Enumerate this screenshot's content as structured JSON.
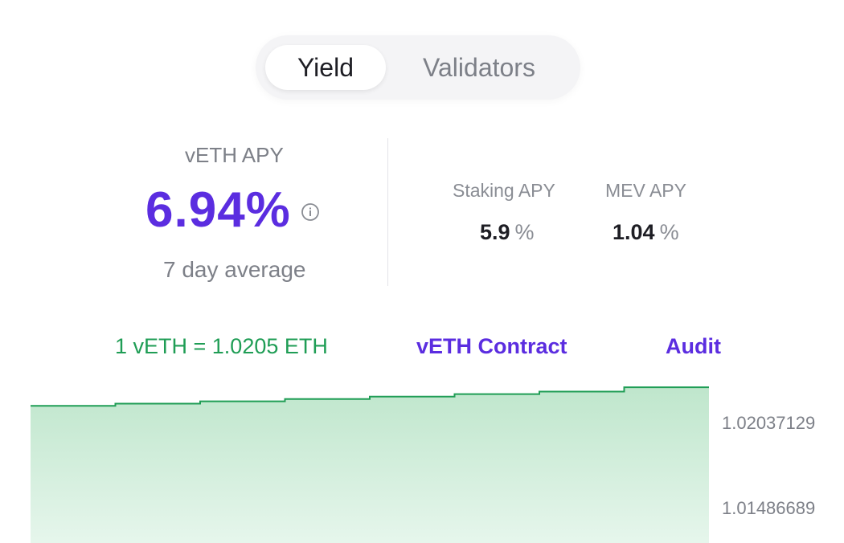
{
  "tabs": {
    "items": [
      {
        "label": "Yield",
        "active": true
      },
      {
        "label": "Validators",
        "active": false
      }
    ]
  },
  "apy": {
    "label": "vETH APY",
    "value": "6.94%",
    "info_icon": "info-circle-icon",
    "subtitle": "7 day average"
  },
  "breakdown": {
    "staking": {
      "label": "Staking APY",
      "value": "5.9",
      "unit": "%"
    },
    "mev": {
      "label": "MEV APY",
      "value": "1.04",
      "unit": "%"
    }
  },
  "links": {
    "rate": "1 vETH = 1.0205 ETH",
    "contract": "vETH Contract",
    "audit": "Audit"
  },
  "colors": {
    "accent": "#5b2de0",
    "positive": "#1f9d55",
    "area_fill": "#c9ebd5"
  },
  "chart_data": {
    "type": "area",
    "y_tick_labels": [
      "1.02037129",
      "1.01486689"
    ],
    "x": [
      0,
      1,
      2,
      3,
      4,
      5,
      6,
      7
    ],
    "values": [
      1.01955,
      1.01965,
      1.01975,
      1.01985,
      1.01996,
      1.02007,
      1.02018,
      1.02037
    ],
    "ylim": [
      1.0135,
      1.0208
    ],
    "grid": false,
    "legend": "none"
  }
}
